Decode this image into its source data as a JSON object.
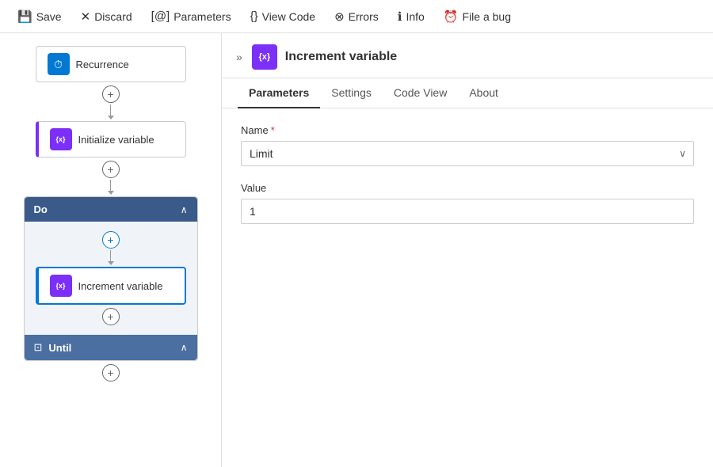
{
  "toolbar": {
    "save_label": "Save",
    "discard_label": "Discard",
    "parameters_label": "Parameters",
    "view_code_label": "View Code",
    "errors_label": "Errors",
    "info_label": "Info",
    "file_bug_label": "File a bug"
  },
  "flow": {
    "nodes": [
      {
        "id": "recurrence",
        "label": "Recurrence",
        "icon_type": "blue",
        "icon": "⏱"
      },
      {
        "id": "init_var",
        "label": "Initialize variable",
        "icon_type": "purple",
        "icon": "{x}"
      },
      {
        "id": "do",
        "label": "Do",
        "type": "loop_header"
      },
      {
        "id": "increment_var",
        "label": "Increment variable",
        "icon_type": "purple",
        "icon": "{x}",
        "selected": true
      },
      {
        "id": "until",
        "label": "Until",
        "type": "loop_footer"
      }
    ]
  },
  "right_panel": {
    "title": "Increment variable",
    "tabs": [
      {
        "id": "parameters",
        "label": "Parameters",
        "active": true
      },
      {
        "id": "settings",
        "label": "Settings",
        "active": false
      },
      {
        "id": "code_view",
        "label": "Code View",
        "active": false
      },
      {
        "id": "about",
        "label": "About",
        "active": false
      }
    ],
    "form": {
      "name_label": "Name",
      "name_required": true,
      "name_value": "Limit",
      "name_placeholder": "Limit",
      "value_label": "Value",
      "value_value": "1"
    }
  }
}
